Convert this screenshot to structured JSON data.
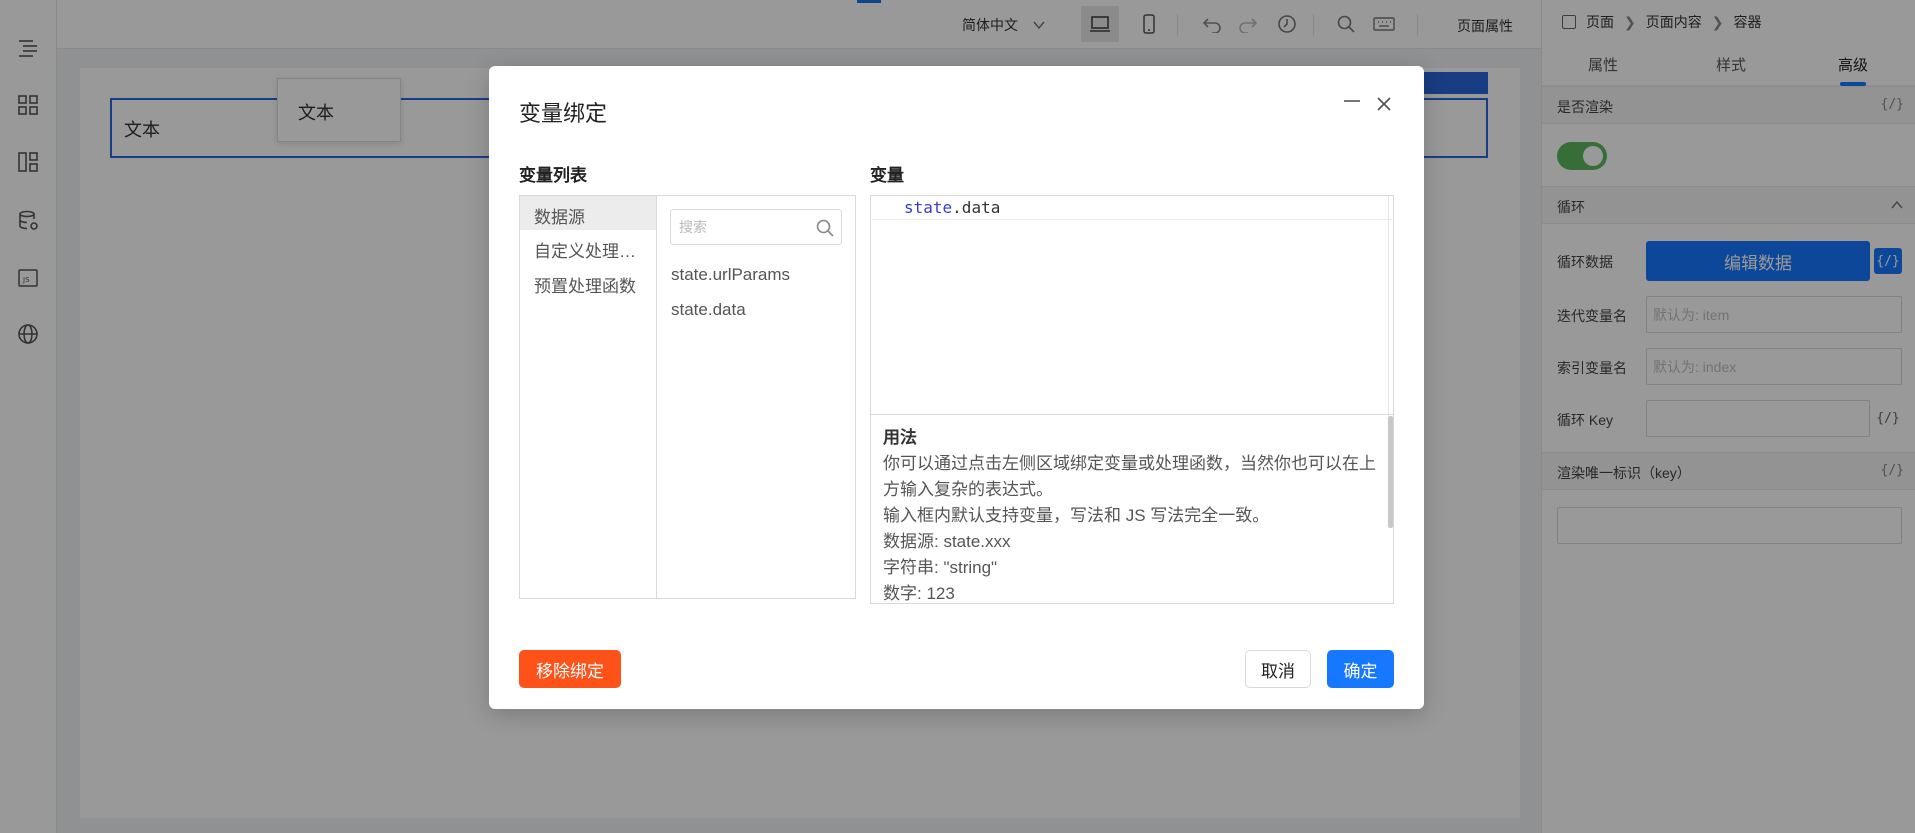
{
  "toolbar": {
    "language": "简体中文",
    "page_properties": "页面属性",
    "icons": [
      "desktop-icon",
      "mobile-icon",
      "undo-icon",
      "redo-icon",
      "history-icon",
      "search-icon",
      "keyboard-icon"
    ]
  },
  "canvas": {
    "text_block": "文本",
    "tooltip": "文本"
  },
  "right_panel": {
    "breadcrumb": [
      "页面",
      "页面内容",
      "容器"
    ],
    "tabs": [
      "属性",
      "样式",
      "高级"
    ],
    "active_tab": "高级",
    "render_section": "是否渲染",
    "render_section_code": "{/}",
    "render_enabled": true,
    "loop_section": "循环",
    "loop_data_label": "循环数据",
    "edit_data_button": "编辑数据",
    "loop_data_code": "{/}",
    "iter_var_label": "迭代变量名",
    "iter_var_placeholder": "默认为: item",
    "index_var_label": "索引变量名",
    "index_var_placeholder": "默认为: index",
    "loop_key_label": "循环 Key",
    "loop_key_code": "{/}",
    "key_section": "渲染唯一标识（key）",
    "key_section_code": "{/}"
  },
  "modal": {
    "title": "变量绑定",
    "var_list_title": "变量列表",
    "var_title": "变量",
    "categories": [
      "数据源",
      "自定义处理…",
      "预置处理函数"
    ],
    "search_placeholder": "搜索",
    "variables": [
      "state.urlParams",
      "state.data"
    ],
    "editor": {
      "keyword": "state",
      "rest": ".data"
    },
    "usage": {
      "title": "用法",
      "lines": [
        "你可以通过点击左侧区域绑定变量或处理函数，当然你也可以在上方输入复杂的表达式。",
        "输入框内默认支持变量，写法和 JS 写法完全一致。",
        "数据源: state.xxx",
        "字符串: \"string\"",
        "数字: 123"
      ]
    },
    "remove_button": "移除绑定",
    "cancel_button": "取消",
    "ok_button": "确定"
  },
  "colors": {
    "accent": "#1677ff",
    "danger": "#ff5219",
    "toggle_on": "#5cb85c"
  }
}
